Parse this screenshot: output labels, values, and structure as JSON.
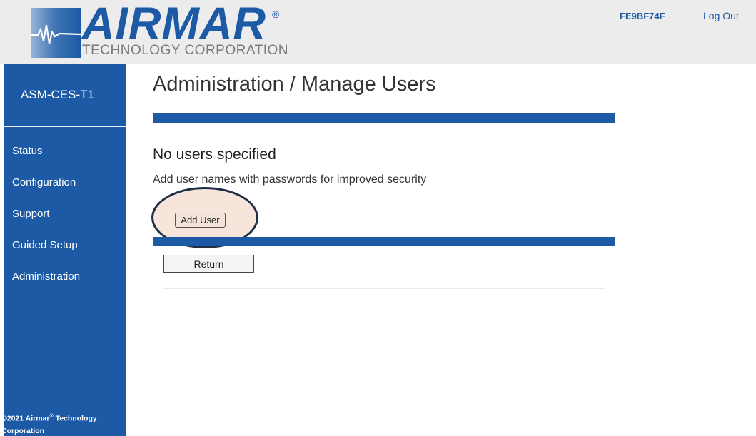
{
  "header": {
    "logo_word": "AIRMAR",
    "logo_registered": "®",
    "logo_subtitle": "TECHNOLOGY CORPORATION",
    "device_id": "FE9BF74F",
    "logout_label": "Log Out"
  },
  "sidebar": {
    "title": "ASM-CES-T1",
    "items": [
      {
        "label": "Status"
      },
      {
        "label": "Configuration"
      },
      {
        "label": "Support"
      },
      {
        "label": "Guided Setup"
      },
      {
        "label": "Administration"
      }
    ],
    "footer_year": "©2021 Airmar",
    "footer_reg": "®",
    "footer_rest": " Technology Corporation"
  },
  "main": {
    "title": "Administration / Manage Users",
    "status_heading": "No users specified",
    "status_text": "Add user names with passwords for improved security",
    "add_user_label": "Add User",
    "return_label": "Return"
  },
  "colors": {
    "brand": "#1c5aa6",
    "header_bg": "#ececec",
    "highlight_fill": "#f7e5dc",
    "highlight_stroke": "#1f2f45"
  },
  "icons": {
    "logo_mark": "sonar-wave-logo-icon"
  }
}
